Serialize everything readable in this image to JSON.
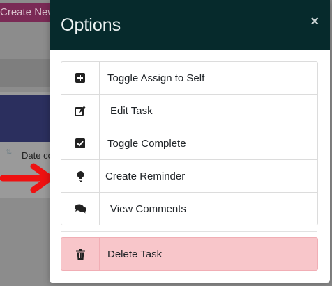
{
  "background": {
    "create_button_label": "Create New",
    "date_column_label": "Date co",
    "dash": "---"
  },
  "modal": {
    "title": "Options",
    "close_glyph": "×",
    "options": [
      {
        "label": "Toggle Assign to Self",
        "icon": "plus-square-icon"
      },
      {
        "label": "Edit Task",
        "icon": "edit-icon"
      },
      {
        "label": "Toggle Complete",
        "icon": "check-square-icon"
      },
      {
        "label": "Create Reminder",
        "icon": "lightbulb-icon"
      },
      {
        "label": "View Comments",
        "icon": "comments-icon"
      }
    ],
    "delete": {
      "label": "Delete Task",
      "icon": "trash-icon"
    }
  },
  "colors": {
    "header_bg": "#062a2c",
    "delete_bg": "#f8c6ca",
    "arrow": "#ee1111",
    "overlay": "#8c8c8c"
  }
}
